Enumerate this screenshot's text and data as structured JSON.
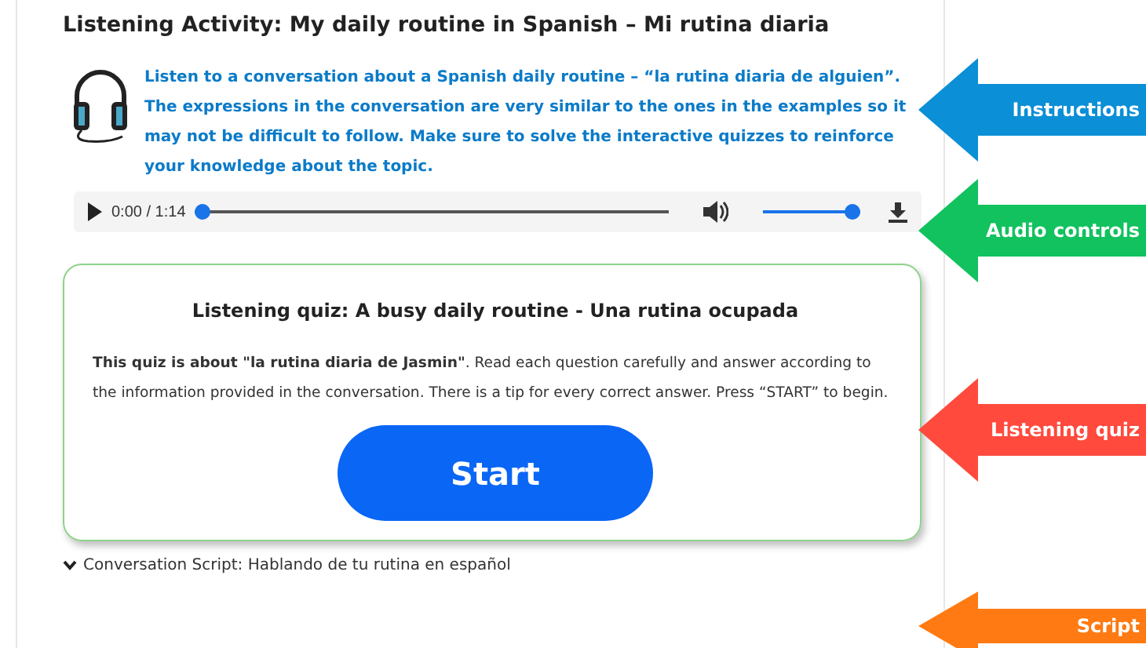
{
  "title": "Listening Activity: My daily routine in Spanish – Mi rutina diaria",
  "instructions": "Listen to a conversation about a Spanish daily routine – “la rutina diaria de alguien”. The expressions in the conversation are very similar to the ones in the examples so it may not be difficult to follow. Make sure to solve the interactive quizzes to reinforce your knowledge about the topic.",
  "audio": {
    "time": "0:00 / 1:14",
    "level": 0,
    "volume": {
      "level": 1
    }
  },
  "quiz": {
    "title": "Listening quiz: A busy daily routine - Una rutina ocupada",
    "text": "**This quiz is about \"la rutina diaria de Jasmin\"**. Read each question carefully and answer according to the information provided in the conversation. There is a tip for every correct answer. Press “START” to begin.",
    "button": "Start"
  },
  "script": {
    "label": "Conversation Script: Hablando de tu rutina en español",
    "expanded": false
  },
  "callouts": [
    {
      "label": "Instructions",
      "color": "#0b8fd6"
    },
    {
      "label": "Audio controls",
      "color": "#11c25f"
    },
    {
      "label": "Listening quiz",
      "color": "#ff4a3d"
    },
    {
      "label": "Script",
      "color": "#ff7a12"
    }
  ]
}
